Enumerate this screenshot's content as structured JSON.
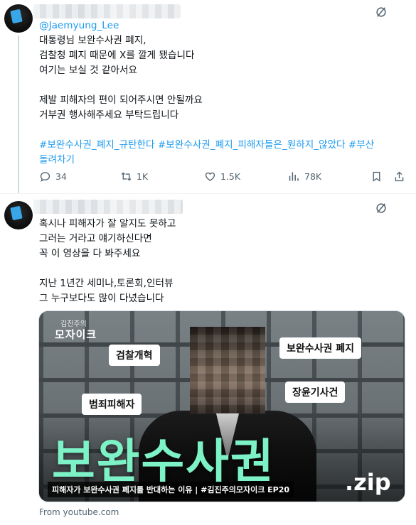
{
  "tweets": [
    {
      "mention": "@Jaemyung_Lee",
      "lines": [
        "대통령님 보완수사권 폐지,",
        "검찰청 폐지 때문에 X를 깔게 됐습니다",
        "여기는 보실 것 같아서요",
        "",
        "제발 피해자의 편이 되어주시면 안될까요",
        "거부권 행사해주세요 부탁드립니다",
        ""
      ],
      "hashtags_line1": "#보완수사권_폐지_규탄한다 #보완수사권_폐지_피해자들은_원하지_않았다 #부산",
      "hashtags_line2": "돌려차기",
      "actions": {
        "replies": "34",
        "reposts": "1K",
        "likes": "1.5K",
        "views": "78K"
      }
    },
    {
      "lines": [
        "혹시나 피해자가 잘 알지도 못하고",
        "그러는 거라고 얘기하신다면",
        "꼭 이 영상을 다 봐주세요",
        "",
        "지난 1년간 세미나,토론회,인터뷰",
        "그 누구보다도 많이 다녔습니다"
      ],
      "media": {
        "series_small": "김진주의",
        "series_big": "모자이크",
        "tag_prosecution_reform": "검찰개혁",
        "tag_crime_victim": "범죄피해자",
        "tag_abolish_supplementary": "보완수사권 폐지",
        "tag_jangyun_case": "장윤기사건",
        "big_title": "보완수사권",
        "zip": ".zip",
        "caption": "피해자가 보완수사권 폐지를 반대하는 이유 | #김진주의모자이크 EP20"
      },
      "source": "From youtube.com"
    }
  ]
}
